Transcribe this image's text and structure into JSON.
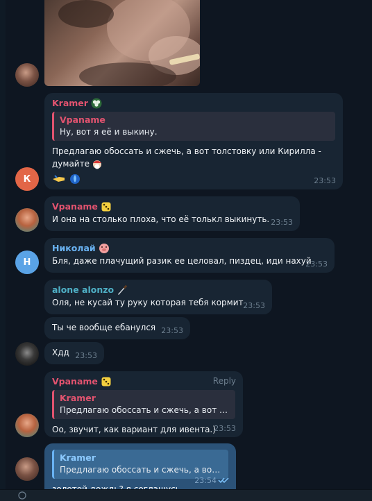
{
  "colors": {
    "background": "#0e1621",
    "bubble_in": "#182533",
    "bubble_out": "#2b5278",
    "name_pink": "#e2536f",
    "name_blue": "#6ab3f3",
    "name_teal": "#4fb0c6",
    "time": "#6d7f8f",
    "avatar_k": "#e26647",
    "avatar_n": "#5aa3e6"
  },
  "messages": {
    "m1": {
      "sender": "Kramer",
      "reply_name": "Vpaname",
      "reply_text": "Ну, вот я её и выкину.",
      "text_line1": "Предлагаю обоссать и сжечь, а вот толстовку или Кирилла -",
      "text_line2": "думайте",
      "time": "23:53",
      "avatar_letter": "К"
    },
    "m2": {
      "sender": "Vpaname",
      "text": "И она на столько плоха, что её толькл выкинуть.",
      "time": "23:53"
    },
    "m3": {
      "sender": "Николай",
      "text": "Бля, даже плачущий разик ее целовал, пиздец, иди нахуй",
      "time": "23:53",
      "avatar_letter": "Н"
    },
    "m4": {
      "sender": "alone alonzo",
      "text": "Оля, не кусай ту руку которая тебя кормит",
      "time": "23:53"
    },
    "m5": {
      "text": "Ты че вообще ебанулся",
      "time": "23:53"
    },
    "m6": {
      "text": "Хдд",
      "time": "23:53"
    },
    "m7": {
      "sender": "Vpaname",
      "reply_label": "Reply",
      "reply_name": "Kramer",
      "reply_text": "Предлагаю обоссать и сжечь, а вот то...",
      "text": "Оо, звучит, как вариант для ивента.)",
      "time": "23:53"
    },
    "m8": {
      "reply_name": "Kramer",
      "reply_text": "Предлагаю обоссать и сжечь, а вот ...",
      "text": "золотой дождь? я соглашусь.",
      "time": "23:54"
    }
  }
}
